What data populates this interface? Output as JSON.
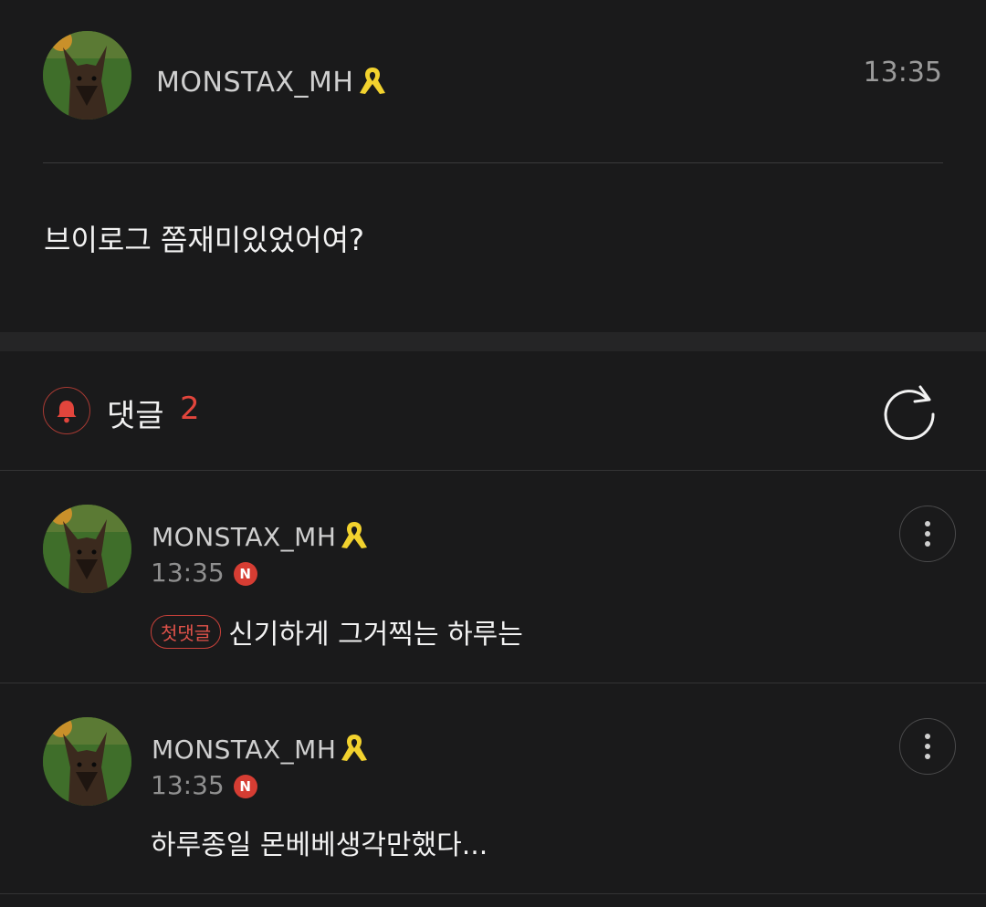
{
  "post": {
    "author": "MONSTAX_MH",
    "time": "13:35",
    "body": "브이로그 쫌재미있었어여?"
  },
  "comments_section": {
    "label": "댓글",
    "count": "2",
    "icons": {
      "bell": "bell-icon",
      "refresh": "refresh-icon"
    }
  },
  "comments": [
    {
      "author": "MONSTAX_MH",
      "time": "13:35",
      "badge_n": "N",
      "first_badge": "첫댓글",
      "text": "신기하게 그거찍는 하루는"
    },
    {
      "author": "MONSTAX_MH",
      "time": "13:35",
      "badge_n": "N",
      "text": "하루종일 몬베베생각만했다..."
    }
  ],
  "colors": {
    "accent": "#e2453c",
    "ribbon": "#f2d22e",
    "background": "#1a1a1b"
  }
}
